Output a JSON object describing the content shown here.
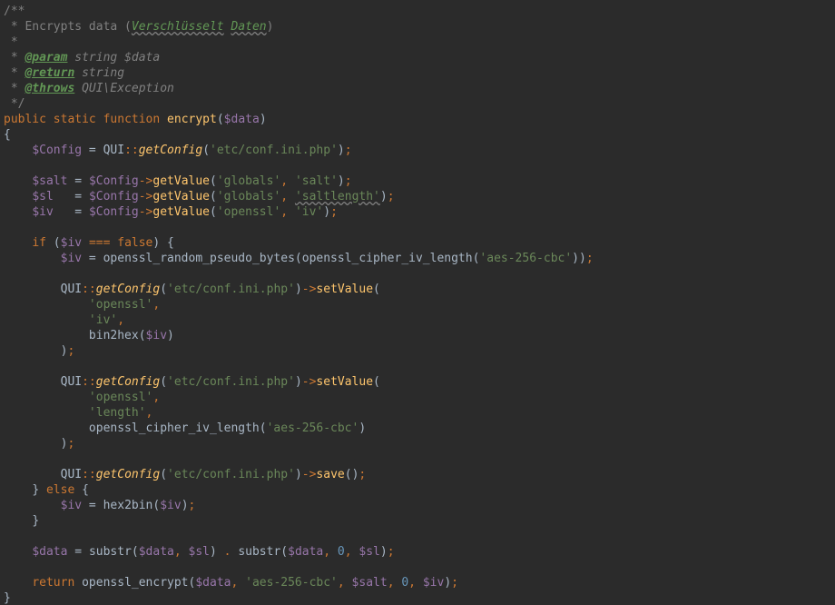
{
  "comment": {
    "open": "/**",
    "star": " *",
    "desc_prefix": " * Encrypts data (",
    "desc_w1": "Versch­lüsselt",
    "desc_w2": "Daten",
    "desc_close": ")",
    "param_tag": "@param",
    "param_rest": " string $data",
    "return_tag": "@return",
    "return_rest": " string",
    "throws_tag": "@throws",
    "throws_rest": " QUI\\Exception",
    "close": " */"
  },
  "kw": {
    "public": "public",
    "static": "static",
    "function": "function",
    "if": "if",
    "else": "else",
    "return": "return",
    "false": "false",
    "eq3": "===",
    "comma": ",",
    "sc": ";",
    "arrow": "->",
    "scope": "::",
    "dot": "."
  },
  "id": {
    "encrypt": "encrypt",
    "QUI": "QUI",
    "getConfig": "getConfig",
    "getValue": "getValue",
    "setValue": "setValue",
    "save": "save",
    "substr": "substr",
    "bin2hex": "bin2hex",
    "hex2bin": "hex2bin",
    "orpb": "openssl_random_pseudo_bytes",
    "ocil": "openssl_cipher_iv_length",
    "oenc": "openssl_encrypt"
  },
  "var": {
    "data": "$data",
    "Config": "$Config",
    "salt": "$salt",
    "sl": "$sl",
    "iv": "$iv"
  },
  "str": {
    "conf": "'etc/conf.ini.php'",
    "globals": "'globals'",
    "salt": "'salt'",
    "saltlength": "'saltlength'",
    "openssl": "'openssl'",
    "iv": "'iv'",
    "length": "'length'",
    "cipher": "'aes-256-cbc'"
  },
  "num": {
    "zero": "0"
  },
  "br": {
    "op": "(",
    "cp": ")",
    "oc": "{",
    "cc": "}"
  }
}
